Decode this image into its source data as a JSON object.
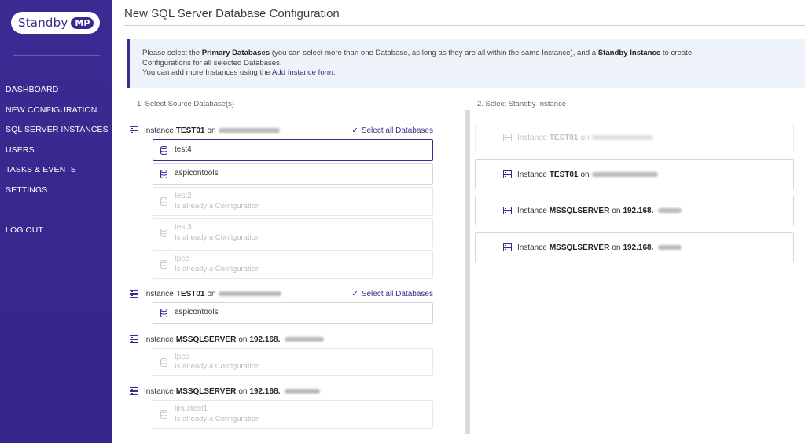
{
  "app": {
    "logo_text": "Standby",
    "logo_badge": "MP"
  },
  "sidebar": {
    "items": [
      {
        "label": "DASHBOARD"
      },
      {
        "label": "NEW CONFIGURATION"
      },
      {
        "label": "SQL SERVER INSTANCES"
      },
      {
        "label": "USERS"
      },
      {
        "label": "TASKS & EVENTS"
      },
      {
        "label": "SETTINGS"
      }
    ],
    "logout": "LOG OUT"
  },
  "page": {
    "title": "New SQL Server Database Configuration"
  },
  "info": {
    "line1_pre": "Please select the ",
    "line1_bold1": "Primary Databases",
    "line1_mid": " (you can select more than one Database, as long as they are all within the same Instance), and a ",
    "line1_bold2": "Standby Instance",
    "line1_post": " to create",
    "line2": "Configurations for all selected Databases.",
    "line3_pre": "You can add more Instances using the ",
    "line3_link": "Add Instance form",
    "line3_post": "."
  },
  "source": {
    "label": "1. Select Source Database(s)",
    "select_all": "Select all Databases",
    "instance_word": "Instance",
    "on_word": "on",
    "already": "Is already a Configuration",
    "groups": [
      {
        "name": "TEST01",
        "host": "",
        "databases": [
          {
            "name": "test4"
          },
          {
            "name": "aspicontools"
          },
          {
            "name": "test2"
          },
          {
            "name": "test3"
          },
          {
            "name": "tpcc"
          }
        ]
      },
      {
        "name": "TEST01",
        "host": "",
        "databases": [
          {
            "name": "aspicontools"
          }
        ]
      },
      {
        "name": "MSSQLSERVER",
        "host": "192.168.",
        "databases": [
          {
            "name": "tpcc"
          }
        ]
      },
      {
        "name": "MSSQLSERVER",
        "host": "192.168.",
        "databases": [
          {
            "name": "linuxtest1"
          }
        ]
      }
    ]
  },
  "standby": {
    "label": "2. Select Standby Instance",
    "instances": [
      {
        "name": "TEST01",
        "host": ""
      },
      {
        "name": "TEST01",
        "host": ""
      },
      {
        "name": "MSSQLSERVER",
        "host": "192.168."
      },
      {
        "name": "MSSQLSERVER",
        "host": "192.168."
      }
    ]
  },
  "colors": {
    "brand": "#3a2a8f",
    "info_bg": "#eef3f9"
  },
  "icons": {
    "server": "server-icon",
    "database": "database-icon",
    "check": "check-icon"
  }
}
